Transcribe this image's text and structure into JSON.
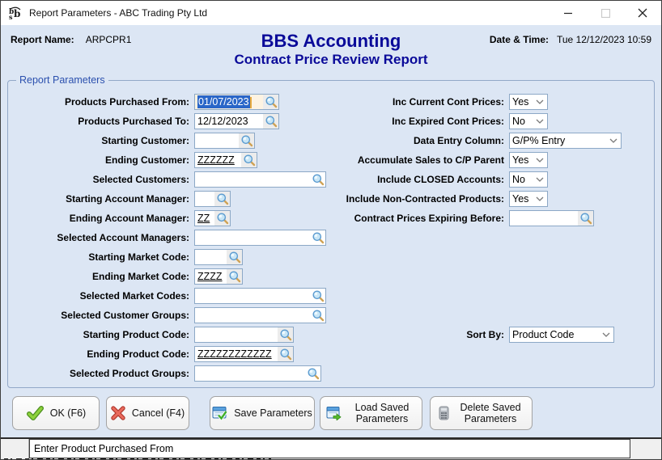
{
  "window": {
    "title": "Report Parameters - ABC Trading Pty Ltd"
  },
  "header": {
    "report_name_label": "Report Name:",
    "report_name_value": "ARPCPR1",
    "app_title": "BBS Accounting",
    "report_title": "Contract Price Review Report",
    "datetime_label": "Date & Time:",
    "datetime_value": "Tue 12/12/2023 10:59"
  },
  "group_legend": "Report Parameters",
  "fields_left": [
    {
      "id": "products-purchased-from",
      "label": "Products Purchased From:",
      "value": "01/07/2023",
      "type": "lookup",
      "selected": true
    },
    {
      "id": "products-purchased-to",
      "label": "Products Purchased To:",
      "value": "12/12/2023",
      "type": "lookup"
    },
    {
      "id": "starting-customer",
      "label": "Starting Customer:",
      "value": "",
      "type": "lookup"
    },
    {
      "id": "ending-customer",
      "label": "Ending Customer:",
      "value": "ZZZZZZ",
      "type": "lookup",
      "underline": true
    },
    {
      "id": "selected-customers",
      "label": "Selected Customers:",
      "value": "",
      "type": "lookup"
    },
    {
      "id": "starting-account-manager",
      "label": "Starting Account Manager:",
      "value": "",
      "type": "lookup"
    },
    {
      "id": "ending-account-manager",
      "label": "Ending Account Manager:",
      "value": "ZZ",
      "type": "lookup",
      "underline": true
    },
    {
      "id": "selected-account-managers",
      "label": "Selected Account Managers:",
      "value": "",
      "type": "lookup"
    },
    {
      "id": "starting-market-code",
      "label": "Starting Market Code:",
      "value": "",
      "type": "lookup"
    },
    {
      "id": "ending-market-code",
      "label": "Ending Market Code:",
      "value": "ZZZZ",
      "type": "lookup",
      "underline": true
    },
    {
      "id": "selected-market-codes",
      "label": "Selected Market Codes:",
      "value": "",
      "type": "lookup"
    },
    {
      "id": "selected-customer-groups",
      "label": "Selected Customer Groups:",
      "value": "",
      "type": "lookup"
    },
    {
      "id": "starting-product-code",
      "label": "Starting Product Code:",
      "value": "",
      "type": "lookup"
    },
    {
      "id": "ending-product-code",
      "label": "Ending Product Code:",
      "value": "ZZZZZZZZZZZZ",
      "type": "lookup",
      "underline": true
    },
    {
      "id": "selected-product-groups",
      "label": "Selected Product Groups:",
      "value": "",
      "type": "lookup"
    }
  ],
  "fields_right": [
    {
      "id": "inc-current-cont-prices",
      "label": "Inc Current Cont Prices:",
      "value": "Yes",
      "type": "select"
    },
    {
      "id": "inc-expired-cont-prices",
      "label": "Inc Expired Cont Prices:",
      "value": "No",
      "type": "select"
    },
    {
      "id": "data-entry-column",
      "label": "Data Entry Column:",
      "value": "G/P% Entry",
      "type": "select"
    },
    {
      "id": "accumulate-sales-to-cp-parent",
      "label": "Accumulate Sales to C/P Parent",
      "value": "Yes",
      "type": "select"
    },
    {
      "id": "include-closed-accounts",
      "label": "Include CLOSED Accounts:",
      "value": "No",
      "type": "select"
    },
    {
      "id": "include-non-contracted-products",
      "label": "Include Non-Contracted Products:",
      "value": "Yes",
      "type": "select"
    },
    {
      "id": "contract-prices-expiring-before",
      "label": "Contract Prices Expiring Before:",
      "value": "",
      "type": "lookup"
    }
  ],
  "sort_field": {
    "id": "sort-by",
    "label": "Sort By:",
    "value": "Product Code",
    "type": "select"
  },
  "buttons": [
    {
      "id": "ok",
      "label": "OK (F6)",
      "icon": "check-icon"
    },
    {
      "id": "cancel",
      "label": "Cancel (F4)",
      "icon": "cross-icon"
    },
    {
      "id": "save-parameters",
      "label": "Save Parameters",
      "icon": "save-icon"
    },
    {
      "id": "load-saved-parameters",
      "label": "Load Saved Parameters",
      "icon": "load-icon"
    },
    {
      "id": "delete-saved-parameters",
      "label": "Delete Saved Parameters",
      "icon": "delete-icon"
    }
  ],
  "statusbar": {
    "message": "Enter Product Purchased From"
  },
  "colors": {
    "title_blue": "#0a0a99",
    "field_border": "#8ca8c6",
    "selection": "#2a66c8",
    "focused_field_bg": "#fdf3e2",
    "ok_green": "#76c043",
    "cancel_red": "#e0544a"
  }
}
